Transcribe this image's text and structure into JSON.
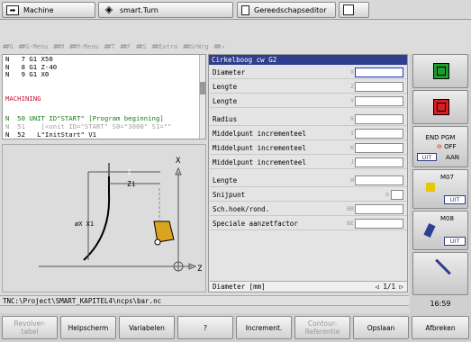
{
  "tabs": [
    {
      "label": "Machine",
      "icon": "arrow-right-icon"
    },
    {
      "label": "smart.Turn",
      "icon": "diamond-arrows-icon"
    },
    {
      "label": "Gereedschapseditor",
      "icon": "tool-icon"
    },
    {
      "label": "",
      "icon": "save-disk-icon"
    }
  ],
  "menubar": [
    "G",
    "G-Menu",
    "M",
    "M-Menu",
    "T",
    "F",
    "S",
    "Extra",
    "GrWrg",
    "↗"
  ],
  "program_lines": [
    {
      "text": "N   7 G1 X50",
      "color": "#000000"
    },
    {
      "text": "N   8 G1 Z-40",
      "color": "#000000"
    },
    {
      "text": "N   9 G1 X0",
      "color": "#000000"
    },
    {
      "text": "",
      "color": "#000000"
    },
    {
      "text": "MACHINING",
      "color": "#c8102e"
    },
    {
      "text": "",
      "color": "#000000"
    },
    {
      "text": "N  50 UNIT ID\"START\" [Program beginning]",
      "color": "#1a7a1a"
    },
    {
      "text": "N  51    [<unit ID=\"START\" S0=\"3000\" S1=\"\"",
      "color": "#a0a0a0"
    },
    {
      "text": "N  52   L\"InitStart\" V1",
      "color": "#000000"
    }
  ],
  "graphic": {
    "x_label": "X",
    "z_label": "Z",
    "zi_label": "Zi",
    "z_dim_label": "Z",
    "xi_label": "øX X1"
  },
  "form": {
    "title": "Cirkelboog cw G2",
    "rows": [
      {
        "label": "Diameter",
        "var": "X"
      },
      {
        "label": "Lengte",
        "var": "Z"
      },
      {
        "label": "Lengte",
        "var": "Y"
      },
      {
        "label": "Radius",
        "var": "R"
      },
      {
        "label": "Middelpunt incrementeel",
        "var": "I"
      },
      {
        "label": "Middelpunt incrementeel",
        "var": "K"
      },
      {
        "label": "Middelpunt incrementeel",
        "var": "J"
      },
      {
        "label": "Lengte",
        "var": "W"
      },
      {
        "label": "Snijpunt",
        "var": "O"
      },
      {
        "label": "Sch.hoek/rond.",
        "var": "BR"
      },
      {
        "label": "Speciale aanzetfactor",
        "var": "BE"
      }
    ],
    "status": "Diameter [mm]",
    "pager": "1/1"
  },
  "side_keys": {
    "end_pgm": "END PGM",
    "off": "OFF",
    "uit": "UIT",
    "aan": "AAN",
    "m07": "M07",
    "m08": "M08",
    "uit2": "UIT",
    "uit3": "UIT"
  },
  "statusbar": "TNC:\\Project\\SMART_KAPITEL4\\ncps\\bar.nc",
  "clock": "16:59",
  "softkeys": [
    {
      "label": "Revolver-\ntabel",
      "enabled": false
    },
    {
      "label": "Helpscherm",
      "enabled": true
    },
    {
      "label": "Variabelen",
      "enabled": true
    },
    {
      "label": "?",
      "enabled": true
    },
    {
      "label": "Increment.",
      "enabled": true
    },
    {
      "label": "Contour-\nReferentie",
      "enabled": false
    },
    {
      "label": "Opslaan",
      "enabled": true
    },
    {
      "label": "Afbreken",
      "enabled": true
    }
  ],
  "colors": {
    "accent": "#2e3f8f",
    "green_key": "#1f9a2e",
    "red_key": "#d42020"
  }
}
